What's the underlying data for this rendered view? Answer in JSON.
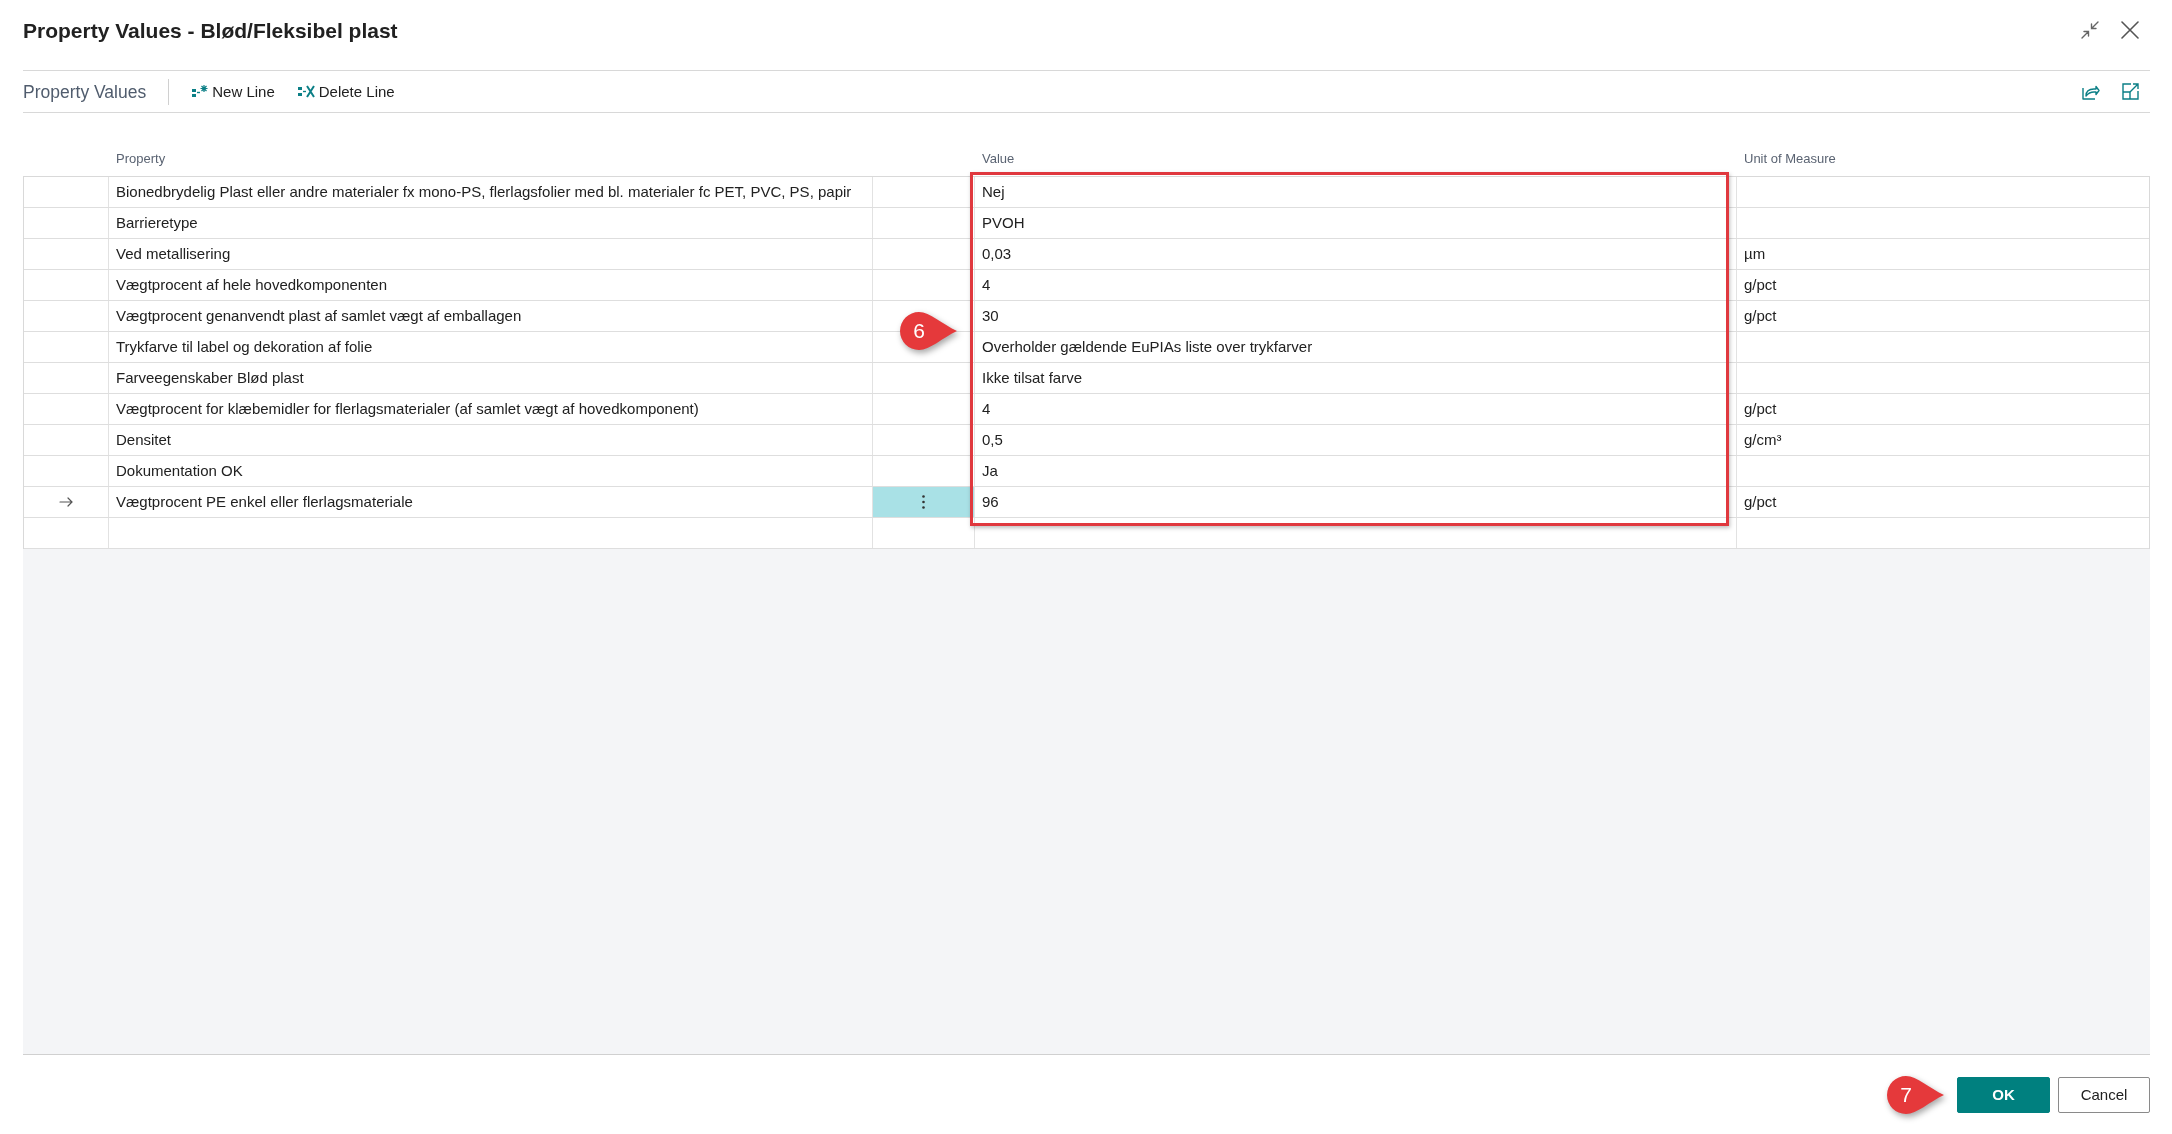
{
  "dialog": {
    "title": "Property Values - Blød/Fleksibel plast"
  },
  "toolbar": {
    "title": "Property Values",
    "actions": [
      {
        "kind": "new",
        "label": "New Line"
      },
      {
        "kind": "delete",
        "label": "Delete Line"
      }
    ]
  },
  "table": {
    "columns": [
      "Property",
      "Value",
      "Unit of Measure"
    ],
    "rows": [
      {
        "property": "Bionedbrydelig Plast eller andre materialer fx mono-PS, flerlagsfolier med bl. materialer fc PET, PVC, PS, papir",
        "value": "Nej",
        "selected": false
      },
      {
        "property": "Barrieretype",
        "value": "PVOH",
        "selected": false
      },
      {
        "property": "Ved metallisering",
        "value": "0,03",
        "unit": "µm",
        "selected": false
      },
      {
        "property": "Vægtprocent af hele hovedkomponenten",
        "value": "4",
        "unit": "g/pct",
        "selected": false
      },
      {
        "property": "Vægtprocent genanvendt plast af samlet vægt af emballagen",
        "value": "30",
        "unit": "g/pct",
        "selected": false
      },
      {
        "property": "Trykfarve til label og dekoration af folie",
        "value": "Overholder gældende EuPIAs liste over trykfarver",
        "selected": false
      },
      {
        "property": "Farveegenskaber Blød plast",
        "value": "Ikke tilsat farve",
        "selected": false
      },
      {
        "property": "Vægtprocent for klæbemidler for flerlagsmaterialer (af samlet vægt af hovedkomponent)",
        "value": "4",
        "unit": "g/pct",
        "selected": false
      },
      {
        "property": "Densitet",
        "value": "0,5",
        "unit": "g/cm³",
        "selected": false
      },
      {
        "property": "Dokumentation OK",
        "value": "Ja",
        "selected": false
      },
      {
        "property": "Vægtprocent PE enkel eller flerlagsmateriale",
        "value": "96",
        "unit": "g/pct",
        "selected": true
      }
    ],
    "highlight_frame": true,
    "step_marker": "6"
  },
  "footer": {
    "step_marker": "7",
    "buttons": [
      {
        "kind": "primary",
        "label": "OK"
      },
      {
        "kind": "secondary",
        "label": "Cancel"
      }
    ]
  }
}
